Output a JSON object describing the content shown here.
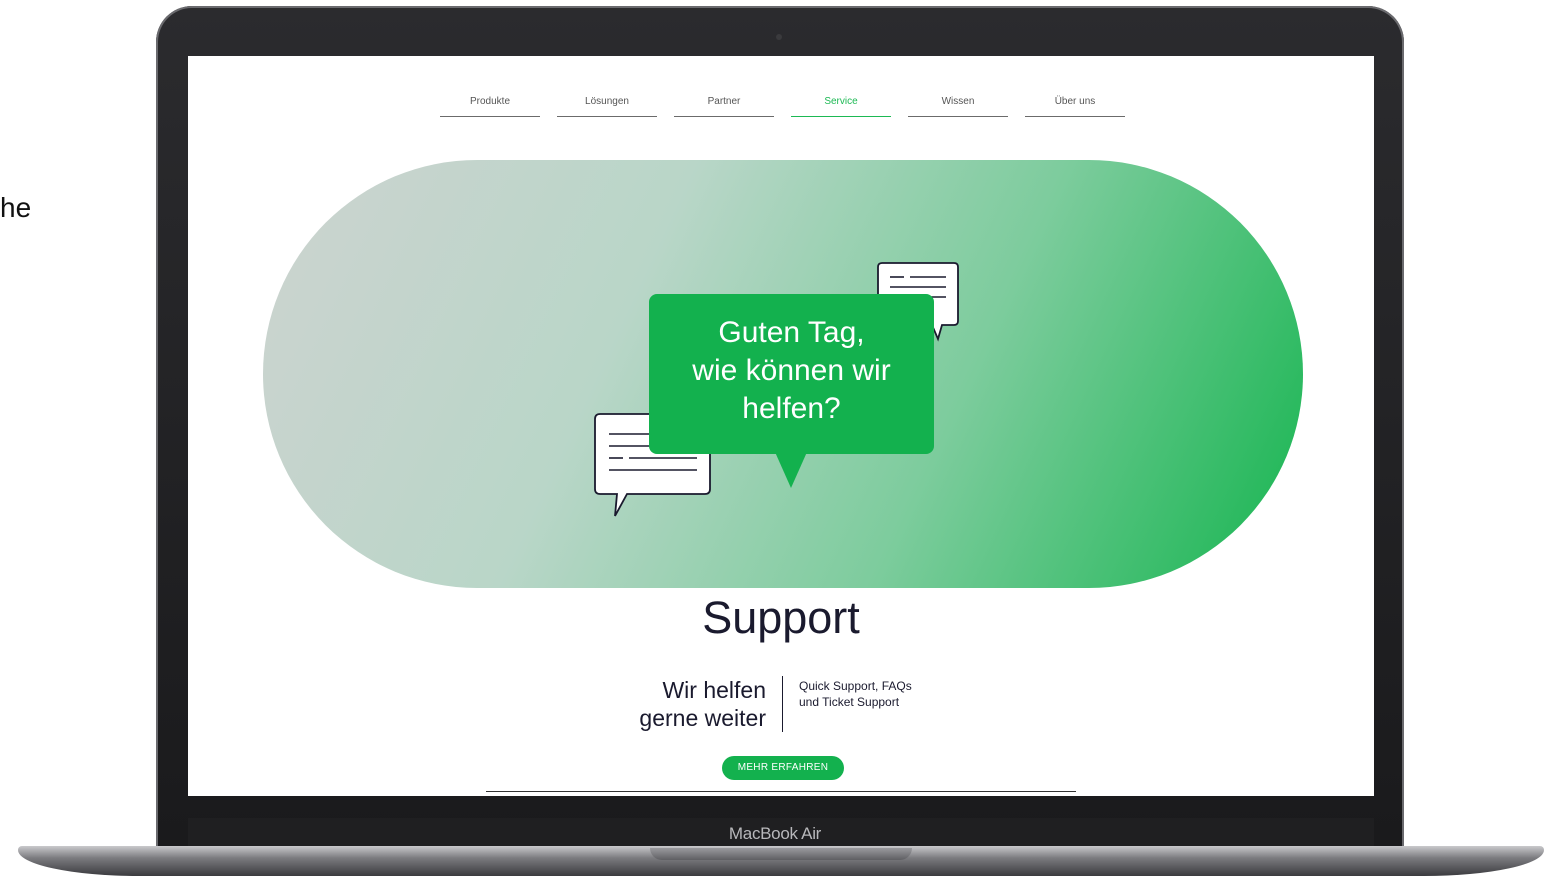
{
  "side_text": "he",
  "laptop": {
    "brand": "MacBook Air"
  },
  "nav": {
    "items": [
      {
        "label": "Produkte",
        "active": false
      },
      {
        "label": "Lösungen",
        "active": false
      },
      {
        "label": "Partner",
        "active": false
      },
      {
        "label": "Service",
        "active": true
      },
      {
        "label": "Wissen",
        "active": false
      },
      {
        "label": "Über uns",
        "active": false
      }
    ]
  },
  "hero": {
    "bubble_lines": [
      "Guten Tag,",
      "wie können wir",
      "helfen?"
    ],
    "colors": {
      "gradient_start": "#cdd3d0",
      "gradient_end": "#16b550",
      "bubble": "#13b14e"
    },
    "icons": [
      "chat-bubble-lines-icon",
      "chat-bubble-lines-icon"
    ]
  },
  "page": {
    "title": "Support",
    "tagline_lines": [
      "Wir helfen",
      "gerne weiter"
    ],
    "description_lines": [
      "Quick Support, FAQs",
      "und Ticket Support"
    ],
    "cta_label": "MEHR ERFAHREN"
  },
  "colors": {
    "accent": "#1db954"
  }
}
